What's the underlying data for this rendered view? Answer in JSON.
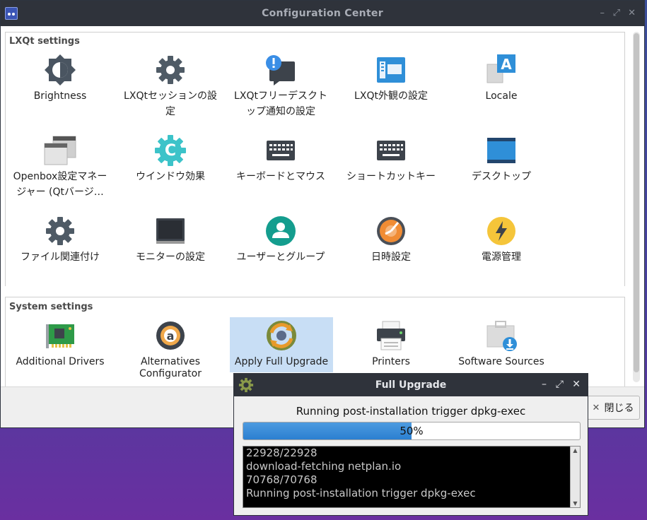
{
  "window": {
    "title": "Configuration Center",
    "controls": [
      "–",
      "⤢",
      "✕"
    ]
  },
  "groups": {
    "lxqt": {
      "label": "LXQt settings"
    },
    "system": {
      "label": "System settings"
    }
  },
  "lxqt_items": [
    {
      "label": "Brightness",
      "icon": "brightness-icon"
    },
    {
      "label": "LXQtセッションの設定",
      "icon": "gear-icon"
    },
    {
      "label": "LXQtフリーデスクトップ通知の設定",
      "icon": "notification-icon"
    },
    {
      "label": "LXQt外観の設定",
      "icon": "appearance-icon"
    },
    {
      "label": "Locale",
      "icon": "locale-icon"
    },
    {
      "label": "Openbox設定マネージャー (Qtバージ…",
      "icon": "windows-icon"
    },
    {
      "label": "ウインドウ効果",
      "icon": "compositor-icon"
    },
    {
      "label": "キーボードとマウス",
      "icon": "keyboard-icon"
    },
    {
      "label": "ショートカットキー",
      "icon": "keyboard-icon"
    },
    {
      "label": "デスクトップ",
      "icon": "desktop-icon"
    },
    {
      "label": "ファイル関連付け",
      "icon": "gear-icon"
    },
    {
      "label": "モニターの設定",
      "icon": "monitor-icon"
    },
    {
      "label": "ユーザーとグループ",
      "icon": "user-icon"
    },
    {
      "label": "日時設定",
      "icon": "clock-icon"
    },
    {
      "label": "電源管理",
      "icon": "power-icon"
    }
  ],
  "system_items": [
    {
      "label": "Additional Drivers",
      "icon": "driver-card-icon"
    },
    {
      "label": "Alternatives Configurator",
      "icon": "alternatives-icon"
    },
    {
      "label": "Apply Full Upgrade",
      "icon": "upgrade-icon"
    },
    {
      "label": "Printers",
      "icon": "printer-icon"
    },
    {
      "label": "Software Sources",
      "icon": "software-sources-icon"
    }
  ],
  "close_button": {
    "label": "閉じる",
    "icon": "close-icon"
  },
  "dialog": {
    "title": "Full Upgrade",
    "controls": [
      "–",
      "⤢",
      "✕"
    ],
    "status": "Running post-installation trigger dpkg-exec",
    "progress": {
      "value": 50,
      "text": "50%"
    },
    "log_lines": [
      "22928/22928",
      "download-fetching netplan.io",
      "70768/70768",
      "Running post-installation trigger dpkg-exec"
    ]
  }
}
